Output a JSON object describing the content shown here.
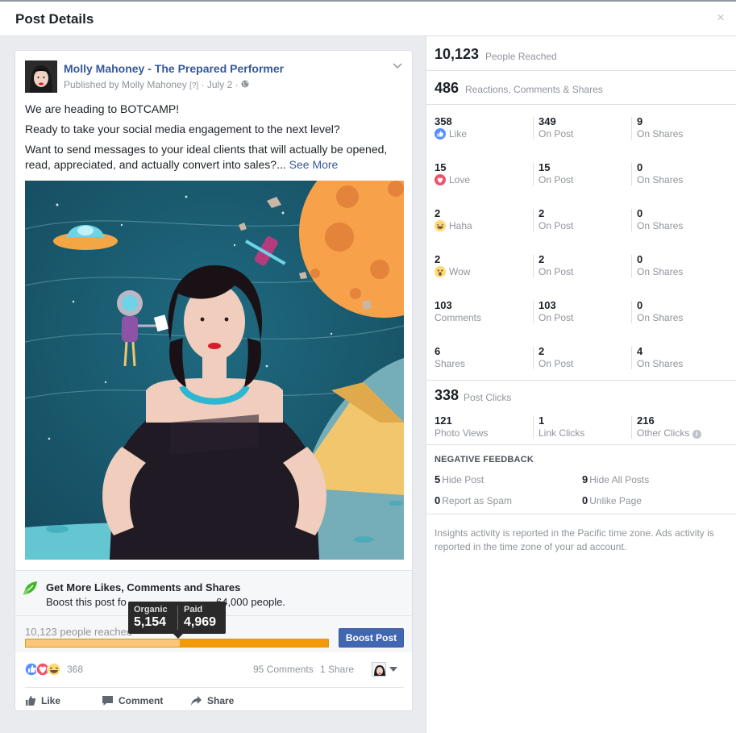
{
  "dialog": {
    "title": "Post Details",
    "close_glyph": "×"
  },
  "post": {
    "page_name": "Molly Mahoney - The Prepared Performer",
    "published_by": "Published by Molly Mahoney",
    "question_mark": "[?]",
    "date": "July 2",
    "line1": "We are heading to BOTCAMP!",
    "line2": "Ready to take your social media engagement to the next level?",
    "line3_a": "Want to send messages to your ideal clients that will actually be opened,",
    "line3_b": "read, appreciated, and actually convert into sales?...",
    "see_more": "See More"
  },
  "boost": {
    "title": "Get More Likes, Comments and Shares",
    "subtitle_prefix": "Boost this post fo",
    "subtitle_suffix": "64,000 people.",
    "reach_text": "10,123 people reached",
    "button": "Boost Post",
    "organic_fraction": 0.508,
    "paid_fraction": 0.492,
    "colors": {
      "organic": "#fbc57a",
      "paid": "#f49a0a",
      "button": "#4267b2"
    }
  },
  "tooltip": {
    "organic_label": "Organic",
    "organic_value": "5,154",
    "paid_label": "Paid",
    "paid_value": "4,969"
  },
  "engagement": {
    "reactions_count": "368",
    "comments": "95 Comments",
    "shares": "1 Share"
  },
  "actions": {
    "like": "Like",
    "comment": "Comment",
    "share": "Share"
  },
  "insights": {
    "people_reached": {
      "value": "10,123",
      "label": "People Reached"
    },
    "total_engagement": {
      "value": "486",
      "label": "Reactions, Comments & Shares"
    },
    "rows": [
      {
        "total": "358",
        "label": "Like",
        "emoji": "like-icon",
        "on_post": "349",
        "on_shares": "9"
      },
      {
        "total": "15",
        "label": "Love",
        "emoji": "love-icon",
        "on_post": "15",
        "on_shares": "0"
      },
      {
        "total": "2",
        "label": "Haha",
        "emoji": "haha-icon",
        "on_post": "2",
        "on_shares": "0"
      },
      {
        "total": "2",
        "label": "Wow",
        "emoji": "wow-icon",
        "on_post": "2",
        "on_shares": "0"
      },
      {
        "total": "103",
        "label": "Comments",
        "emoji": "",
        "on_post": "103",
        "on_shares": "0"
      },
      {
        "total": "6",
        "label": "Shares",
        "emoji": "",
        "on_post": "2",
        "on_shares": "4"
      }
    ],
    "on_post_label": "On Post",
    "on_shares_label": "On Shares",
    "post_clicks": {
      "value": "338",
      "label": "Post Clicks"
    },
    "clicks": [
      {
        "value": "121",
        "label": "Photo Views"
      },
      {
        "value": "1",
        "label": "Link Clicks"
      },
      {
        "value": "216",
        "label": "Other Clicks"
      }
    ],
    "negative": {
      "title": "NEGATIVE FEEDBACK",
      "items": [
        {
          "value": "5",
          "label": "Hide Post"
        },
        {
          "value": "9",
          "label": "Hide All Posts"
        },
        {
          "value": "0",
          "label": "Report as Spam"
        },
        {
          "value": "0",
          "label": "Unlike Page"
        }
      ]
    },
    "note": "Insights activity is reported in the Pacific time zone. Ads activity is reported in the time zone of your ad account."
  }
}
